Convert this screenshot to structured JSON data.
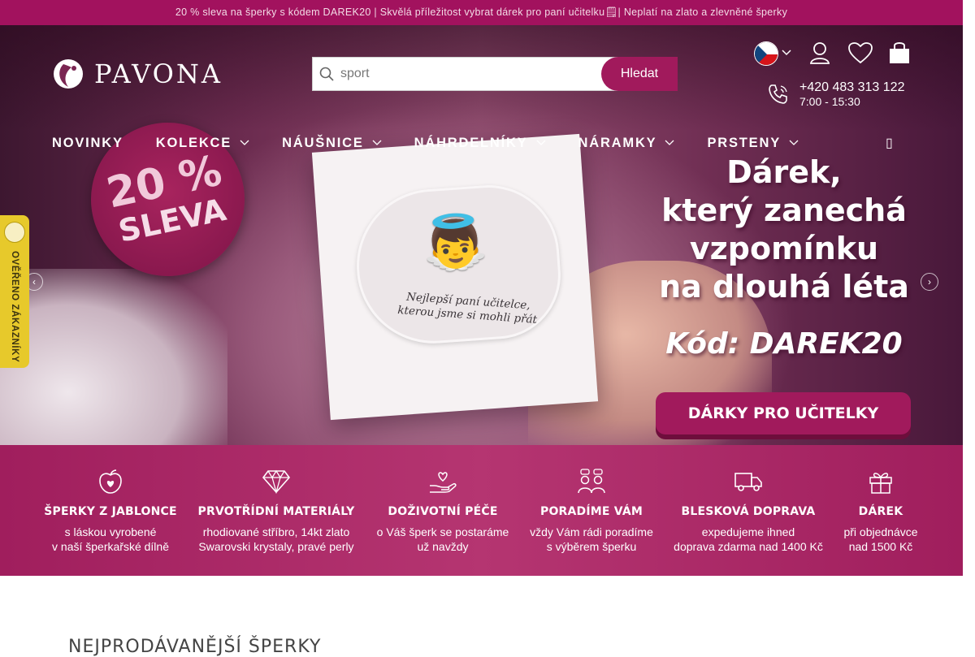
{
  "topbar": {
    "text": "20 % sleva na šperky s kódem DAREK20 | Skvělá příležitost vybrat dárek pro paní učitelku🗒| Neplatí na zlato a zlevněné šperky"
  },
  "header": {
    "logo_text": "PAVONA",
    "search": {
      "value": "sport",
      "button_label": "Hledat"
    },
    "phone": {
      "number": "+420 483 313 122",
      "hours": "7:00 - 15:30"
    }
  },
  "nav": [
    {
      "label": "NOVINKY",
      "dropdown": false
    },
    {
      "label": "KOLEKCE",
      "dropdown": true
    },
    {
      "label": "NÁUŠNICE",
      "dropdown": true
    },
    {
      "label": "NÁHRDELNÍKY",
      "dropdown": true
    },
    {
      "label": "NÁRAMKY",
      "dropdown": true
    },
    {
      "label": "PRSTENY",
      "dropdown": true
    }
  ],
  "hero": {
    "badge": {
      "percent": "20 %",
      "word": "SLEVA"
    },
    "card_text": "Nejlepší paní učitelce, kterou jsme si mohli přát",
    "slogan": [
      "Dárek,",
      "který zanechá",
      "vzpomínku",
      "na dlouhá léta"
    ],
    "code": "Kód: DAREK20",
    "cta": "DÁRKY PRO UČITELKY",
    "slides_total": 4,
    "slide_active": 1
  },
  "trust_badge": {
    "label": "OVĚŘENO ZÁKAZNÍKY"
  },
  "features": [
    {
      "icon": "apple-heart-icon",
      "title": "ŠPERKY Z JABLONCE",
      "line1": "s láskou vyrobené",
      "line2": "v naší šperkařské dílně"
    },
    {
      "icon": "diamond-icon",
      "title": "PRVOTŘÍDNÍ MATERIÁLY",
      "line1": "rhodiované stříbro, 14kt zlato",
      "line2": "Swarovski krystaly, pravé perly"
    },
    {
      "icon": "hand-heart-icon",
      "title": "DOŽIVOTNÍ PÉČE",
      "line1": "o Váš šperk se postaráme",
      "line2": "už navždy"
    },
    {
      "icon": "people-chat-icon",
      "title": "PORADÍME VÁM",
      "line1": "vždy Vám rádi poradíme",
      "line2": "s výběrem šperku"
    },
    {
      "icon": "truck-icon",
      "title": "BLESKOVÁ DOPRAVA",
      "line1": "expedujeme ihned",
      "line2": "doprava zdarma nad 1400 Kč"
    },
    {
      "icon": "gift-icon",
      "title": "DÁREK",
      "line1": "při objednávce",
      "line2": "nad 1500 Kč"
    }
  ],
  "section_title": "NEJPRODÁVANĚJŠÍ ŠPERKY",
  "colors": {
    "brand": "#a11a5c",
    "topbar": "#a2125e",
    "trust": "#e7c92b"
  }
}
